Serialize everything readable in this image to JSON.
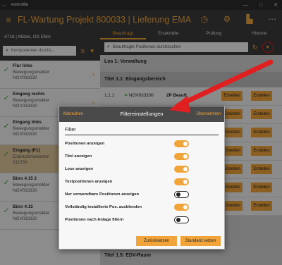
{
  "os": {
    "app_name": "esmobile",
    "back_icon": "back-arrow-icon"
  },
  "header": {
    "title": "FL-Wartung Projekt 800033  |  Lieferung EMA",
    "menu_icon": "hamburger-icon"
  },
  "project": {
    "label": "4718  |  Müller, OS EMA"
  },
  "components": {
    "search_placeholder": "Komponenten durchs...",
    "items": [
      {
        "name": "Flur links",
        "type": "Bewegungsmelder",
        "code": "NOV033330",
        "selected": false
      },
      {
        "name": "Eingang rechts",
        "type": "Bewegungsmelder",
        "code": "NOV033330",
        "selected": false
      },
      {
        "name": "Eingang links",
        "type": "Bewegungsmelder",
        "code": "NOV033330",
        "selected": false
      },
      {
        "name": "Eingang (P1)",
        "type": "Einbruchmeldezen",
        "code": "011250",
        "selected": true
      },
      {
        "name": "Büro 4.15 2",
        "type": "Bewegungsmelder",
        "code": "NOV033330",
        "selected": false
      },
      {
        "name": "Büro 4.15",
        "type": "Bewegungsmelder",
        "code": "NOV033330",
        "selected": false
      }
    ]
  },
  "tabs": [
    "Beauftragt",
    "Ersatzteile",
    "Prüfung",
    "Historie"
  ],
  "positions": {
    "search_placeholder": "Beauftragte Positionen durchsuchen",
    "lot_title": "Los 1: Verwaltung",
    "title_1_1": "Titel 1.1: Eingangsbereich",
    "row": {
      "num": "1.1.1",
      "code": "NOV033330",
      "status": "2P Beauft.",
      "btn1": "Erstellen",
      "btn2": "Erstellen"
    },
    "title_footer": "Titel 1.5: EDV-Raum",
    "btn_label": "Erstellen"
  },
  "dialog": {
    "cancel": "Abbrechen",
    "title": "Filtereinstellungen",
    "apply": "Übernehmen",
    "section": "Filter",
    "options": [
      {
        "label": "Positionen anzeigen",
        "on": true
      },
      {
        "label": "Titel anzeigen",
        "on": true
      },
      {
        "label": "Lose anzeigen",
        "on": true
      },
      {
        "label": "Textpositionen anzeigen",
        "on": true
      },
      {
        "label": "Nur verwendbare Positionen anzeigen",
        "on": false
      },
      {
        "label": "Vollständig installierte Pos. ausblenden",
        "on": true
      },
      {
        "label": "Positionen nach Anlage filtern",
        "on": false
      }
    ],
    "reset": "Zurücksetzen",
    "set_default": "Standard setzen"
  },
  "colors": {
    "accent": "#f0a43a",
    "highlight": "#e02020",
    "check": "#3a9a3a"
  }
}
